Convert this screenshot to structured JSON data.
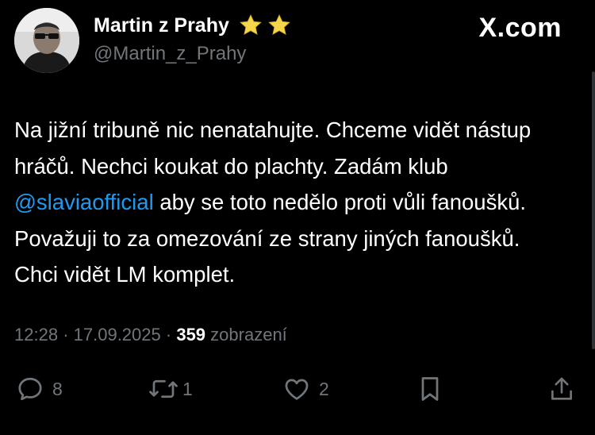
{
  "author": {
    "display_name": "Martin z Prahy",
    "handle": "@Martin_z_Prahy",
    "badge_icons": [
      "star-icon",
      "star-icon"
    ]
  },
  "brand": {
    "label": "X.com"
  },
  "tweet": {
    "text_before_mention": "Na jižní tribuně nic nenatahujte. Chceme vidět nástup hráčů. Nechci koukat do plachty. Zadám klub ",
    "mention": "@slaviaofficial",
    "text_after_mention": " aby se toto nedělo proti vůli fanoušků. Považuji to za omezování ze strany jiných fanoušků. Chci vidět LM komplet."
  },
  "meta": {
    "time": "12:28",
    "separator": "·",
    "date": "17.09.2025",
    "views_count": "359",
    "views_label": "zobrazení"
  },
  "actions": {
    "replies": {
      "icon": "reply-icon",
      "count": "8"
    },
    "reposts": {
      "icon": "repost-icon",
      "count": "1"
    },
    "likes": {
      "icon": "heart-icon",
      "count": "2"
    },
    "bookmark": {
      "icon": "bookmark-icon"
    },
    "share": {
      "icon": "share-icon"
    }
  },
  "colors": {
    "background": "#000000",
    "text": "#ffffff",
    "secondary": "#71767b",
    "mention": "#1d9bf0",
    "star": "#f5d54a"
  }
}
